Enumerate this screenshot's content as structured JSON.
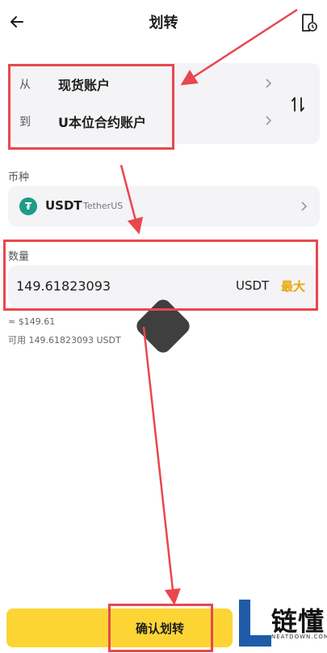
{
  "header": {
    "title": "划转",
    "back_icon": "arrow-left-icon",
    "history_icon": "history-document-icon"
  },
  "transfer": {
    "from_label": "从",
    "from_value": "现货账户",
    "to_label": "到",
    "to_value": "U本位合约账户",
    "swap_icon": "swap-arrows-icon"
  },
  "coin": {
    "section_label": "币种",
    "symbol": "USDT",
    "name": "TetherUS",
    "icon_glyph": "₮"
  },
  "amount": {
    "section_label": "数量",
    "value": "149.61823093",
    "unit": "USDT",
    "max_label": "最大",
    "approx_value": "≈ $149.61",
    "available": "可用 149.61823093 USDT"
  },
  "confirm": {
    "label": "确认划转"
  },
  "watermark": {
    "text": "链懂",
    "subtext": "NEATDOWN.COM"
  },
  "colors": {
    "accent": "#fcd535",
    "max_text": "#e5a800",
    "annotation": "#e8474d",
    "tether": "#1d9c86"
  }
}
